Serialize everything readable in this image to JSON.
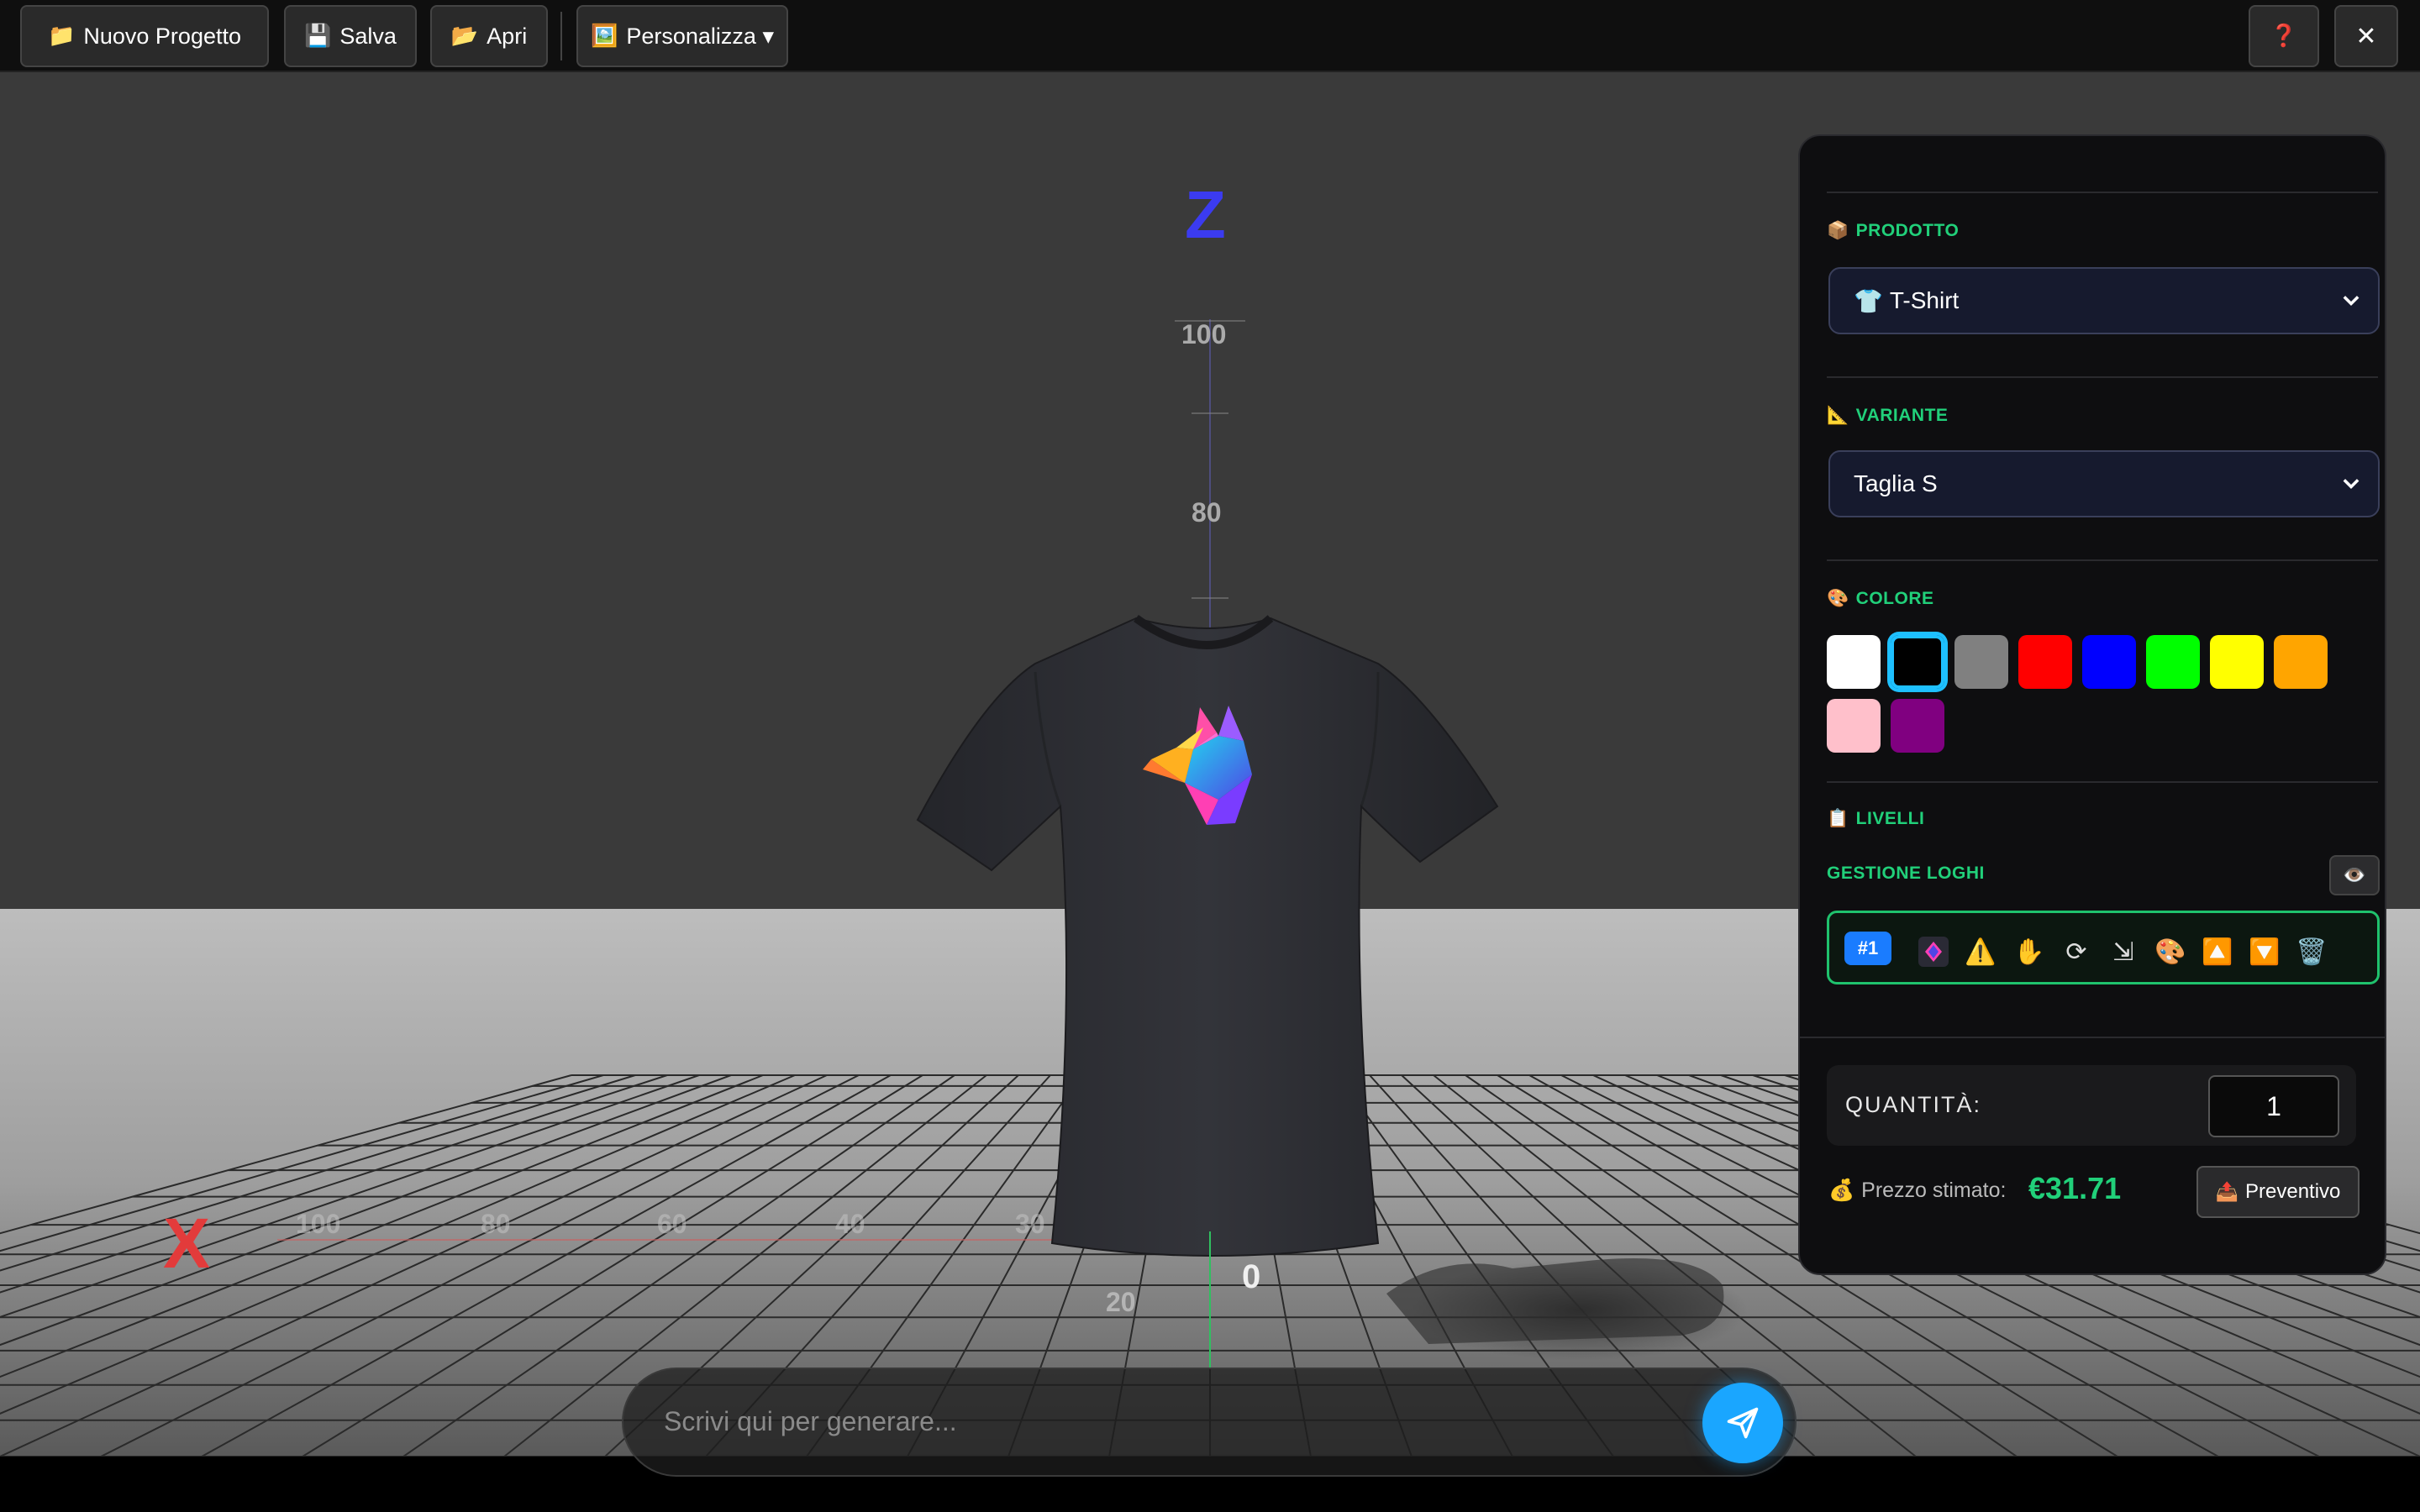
{
  "toolbar": {
    "new_project": {
      "icon": "📁",
      "label": "Nuovo Progetto"
    },
    "save": {
      "icon": "💾",
      "label": "Salva"
    },
    "open": {
      "icon": "📂",
      "label": "Apri"
    },
    "customize": {
      "icon": "🖼️",
      "label": "Personalizza ▾"
    },
    "help": {
      "icon": "❓"
    },
    "close": {
      "icon": "✕"
    }
  },
  "scene": {
    "z_axis_label": "Z",
    "x_axis_label": "X",
    "z_ticks": [
      "100",
      "80"
    ],
    "x_ticks": [
      "100",
      "80",
      "60",
      "40",
      "30"
    ],
    "origin_label": "0",
    "y_tick": "20",
    "colors": {
      "z_axis": "#3b3bf0",
      "x_axis": "#e33b3b",
      "shirt": "#2b2c2f"
    }
  },
  "panel": {
    "product": {
      "icon": "📦",
      "title": "PRODOTTO",
      "value_icon": "👕",
      "value": "T-Shirt"
    },
    "variant": {
      "icon": "📐",
      "title": "VARIANTE",
      "value": "Taglia S"
    },
    "color": {
      "icon": "🎨",
      "title": "COLORE",
      "swatches": [
        "#ffffff",
        "#000000",
        "#808080",
        "#ff0000",
        "#0000ff",
        "#00ff00",
        "#ffff00",
        "#ffa500",
        "#ffc0cb",
        "#800080"
      ],
      "selected": "#000000"
    },
    "layers": {
      "icon": "📋",
      "title": "LIVELLI",
      "subtitle": "GESTIONE LOGHI",
      "eye_icon": "👁️",
      "row": {
        "badge": "#1",
        "icons": [
          "thumbnail-icon",
          "warning-icon",
          "hand-icon",
          "rotate-icon",
          "resize-icon",
          "palette-icon",
          "move-up-icon",
          "move-down-icon",
          "trash-icon"
        ],
        "glyphs": [
          "",
          "⚠️",
          "✋",
          "⟳",
          "⇲",
          "🎨",
          "🔼",
          "🔽",
          "🗑️"
        ]
      }
    },
    "quantity": {
      "label": "QUANTITÀ:",
      "value": "1"
    },
    "price": {
      "icon": "💰",
      "label": "Prezzo stimato:",
      "value": "€31.71"
    },
    "quote_button": {
      "icon": "📤",
      "label": "Preventivo"
    }
  },
  "chat": {
    "placeholder": "Scrivi qui per generare..."
  }
}
